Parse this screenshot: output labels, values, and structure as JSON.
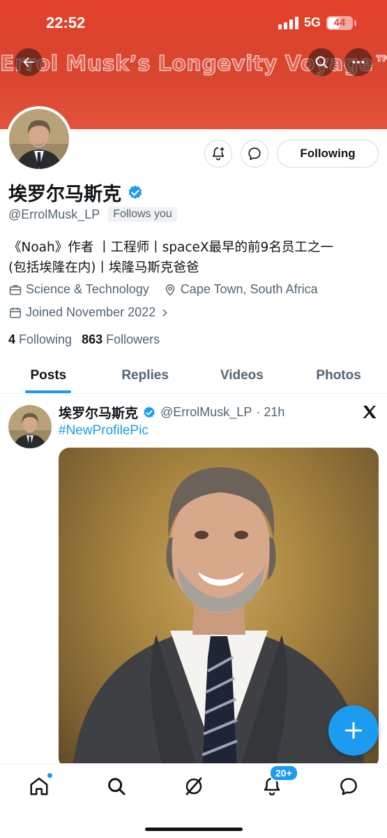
{
  "status_bar": {
    "time": "22:52",
    "network": "5G",
    "battery": "44"
  },
  "header": {
    "banner_title": "Errol Musk’s Longevity Voyage™",
    "back_icon": "arrow-left-icon",
    "search_icon": "search-icon",
    "more_icon": "more-horizontal-icon"
  },
  "profile": {
    "display_name": "埃罗尔马斯克",
    "handle": "@ErrolMusk_LP",
    "follows_you": "Follows you",
    "following_button": "Following",
    "bio_line1": "《Noah》作者 丨工程师丨spaceX最早的前9名员工之一",
    "bio_line2": "(包括埃隆在内)丨埃隆马斯克爸爸",
    "category": "Science & Technology",
    "location": "Cape Town, South Africa",
    "joined": "Joined November 2022",
    "following_count": "4",
    "following_label": "Following",
    "followers_count": "863",
    "followers_label": "Followers"
  },
  "tabs": [
    {
      "label": "Posts",
      "active": true
    },
    {
      "label": "Replies",
      "active": false
    },
    {
      "label": "Videos",
      "active": false
    },
    {
      "label": "Photos",
      "active": false
    }
  ],
  "post": {
    "author_name": "埃罗尔马斯克",
    "author_handle": "@ErrolMusk_LP",
    "time": "· 21h",
    "text": "#NewProfilePic"
  },
  "bottom_nav": {
    "notifications_badge": "20+",
    "items": [
      "home-icon",
      "search-icon",
      "grok-icon",
      "notifications-icon",
      "messages-icon"
    ]
  },
  "colors": {
    "accent": "#1d9bf0",
    "banner": "#d9452f",
    "text": "#0f1419",
    "secondary": "#536471"
  }
}
